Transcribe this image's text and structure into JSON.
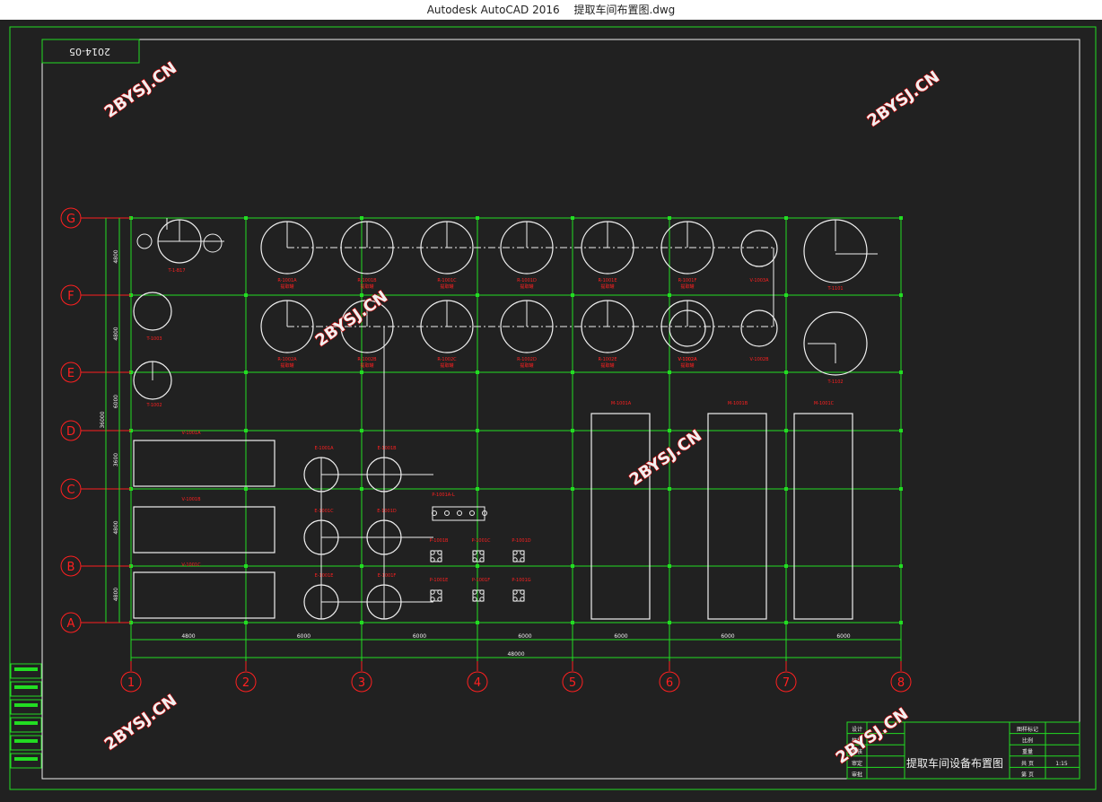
{
  "window": {
    "app": "Autodesk AutoCAD 2016",
    "file": "提取车间布置图.dwg"
  },
  "drawing": {
    "date_stamp": "2014-05",
    "watermark": "2BYSJ.CN",
    "row_axes": [
      "G",
      "F",
      "E",
      "D",
      "C",
      "B",
      "A"
    ],
    "col_axes": [
      "1",
      "2",
      "3",
      "4",
      "5",
      "6",
      "7",
      "8"
    ],
    "total_dim": "48000",
    "bay_dims": [
      "4800",
      "6000",
      "6000",
      "6000",
      "6000",
      "6000",
      "6000"
    ],
    "v_dims": [
      "4800",
      "4800",
      "6000",
      "3600",
      "4800",
      "4800",
      "3600"
    ],
    "total_v_dim": "36000"
  },
  "equipment": {
    "top_row": [
      "R-1001A",
      "R-1001B",
      "R-1001C",
      "R-1001D",
      "R-1001E",
      "R-1001F",
      "V-1003A",
      "T-1101"
    ],
    "second_row": [
      "R-1002A",
      "R-1002B",
      "R-1002C",
      "R-1002D",
      "R-1002E",
      "V-1002A",
      "V-1002B",
      "T-1102"
    ],
    "left_col": [
      "T-1-B17",
      "T-1003",
      "T-1002"
    ],
    "tanks": [
      "V-1001A",
      "V-1001B",
      "V-1001C"
    ],
    "mid": [
      "E-1001A",
      "E-1001B",
      "E-1001C",
      "E-1001D",
      "E-1001E",
      "E-1001F"
    ],
    "small": [
      "P-1001A-L",
      "P-1001B",
      "P-1001C",
      "P-1001D",
      "P-1001E",
      "P-1001F",
      "P-1001G"
    ],
    "tall": [
      "M-1001A",
      "M-1001B",
      "M-1001C"
    ],
    "sub_label": "提取罐"
  },
  "title_block": {
    "title": "提取车间设备布置图",
    "rows_left": [
      "设计",
      "校核",
      "审核",
      "审定",
      "审批"
    ],
    "rows_right": [
      "图样标记",
      "比例",
      "重量",
      "共 页",
      "第 页"
    ],
    "scale": "1:15"
  }
}
